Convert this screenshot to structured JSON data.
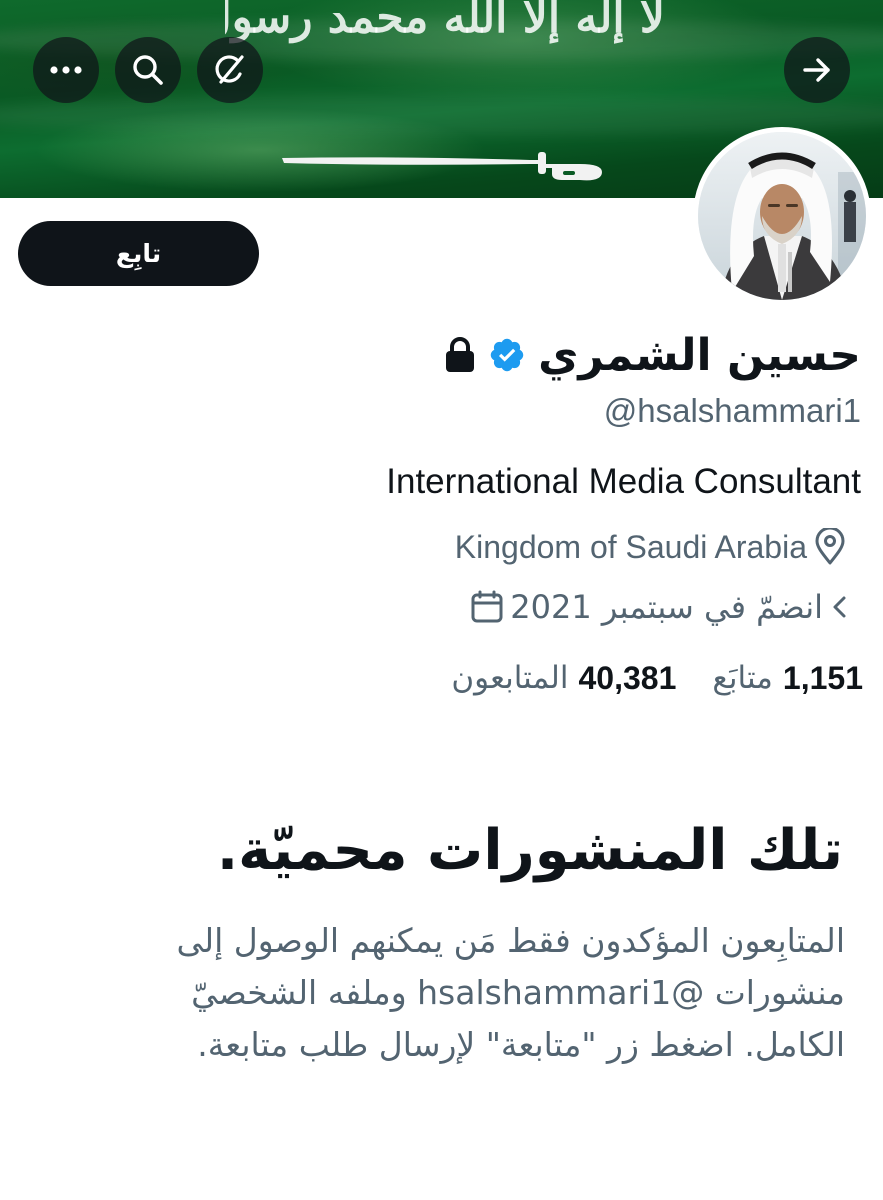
{
  "banner": {
    "flag_text": "لا إله إلا الله محمد رسول الله",
    "colors": {
      "flag_green": "#0a5a24",
      "flag_white": "#ffffff"
    }
  },
  "toolbar": {
    "more_icon": "more-horizontal-icon",
    "search_icon": "search-icon",
    "grok_icon": "grok-icon",
    "forward_icon": "arrow-right-icon"
  },
  "profile": {
    "follow_label": "تابِع",
    "display_name": "حسين الشمري",
    "verified_icon": "verified-badge-icon",
    "protected_icon": "lock-icon",
    "handle": "@hsalshammari1",
    "bio": "International Media Consultant",
    "location": "Kingdom of Saudi Arabia",
    "joined": "انضمّ في سبتمبر 2021",
    "following_count": "1,151",
    "following_label": "متابَع",
    "followers_count": "40,381",
    "followers_label": "المتابعون",
    "accent_color": "#1d9bf0"
  },
  "protected": {
    "title": "تلك المنشورات محميّة.",
    "body": "المتابِعون المؤكدون فقط مَن يمكنهم الوصول إلى منشورات @hsalshammari1 وملفه الشخصيّ الكامل. اضغط زر \"متابعة\" لإرسال طلب متابعة."
  }
}
